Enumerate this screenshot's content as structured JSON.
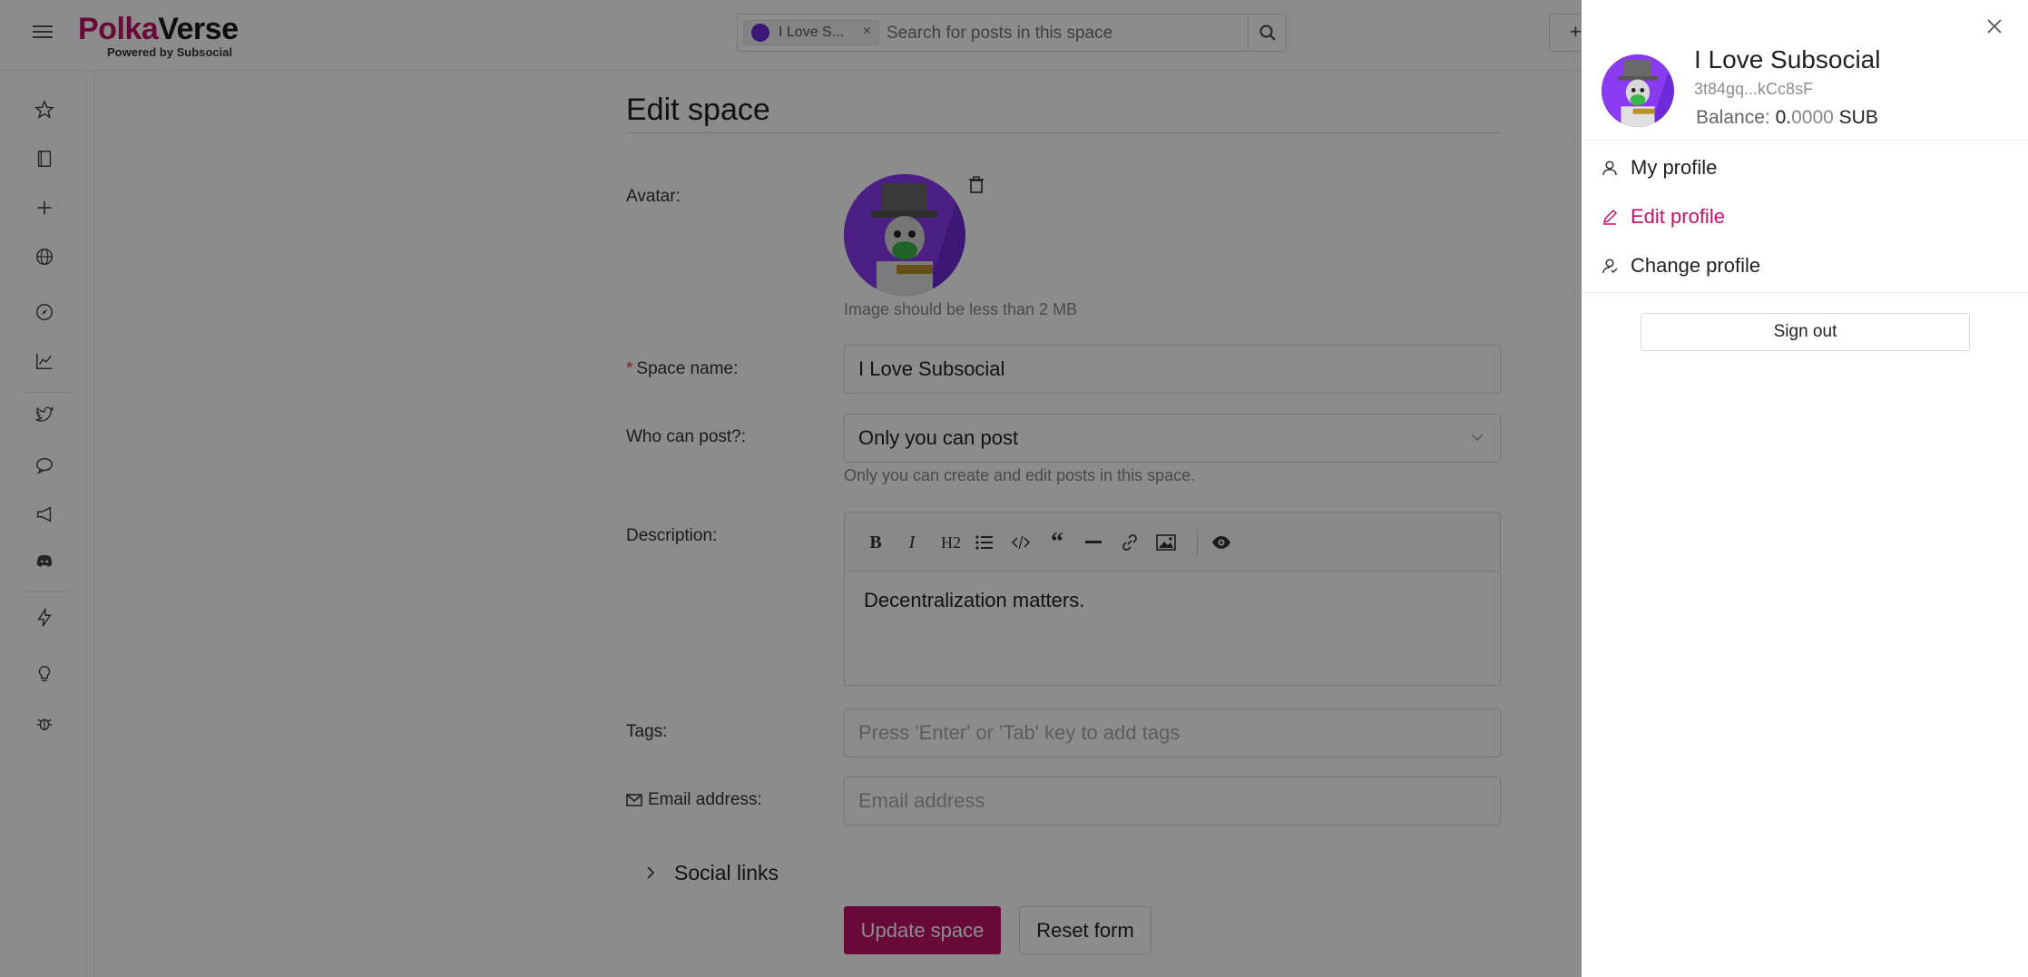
{
  "header": {
    "logo_part1": "Polka",
    "logo_part2": "Verse",
    "logo_subtitle": "Powered by Subsocial",
    "search_chip_label": "I Love S...",
    "search_chip_close": "×",
    "search_placeholder": "Search for posts in this space",
    "new_button_label": "+"
  },
  "sidebar": {
    "icons": [
      "star-icon",
      "book-icon",
      "plus-icon",
      "globe-icon",
      "compass-icon",
      "chart-icon",
      "twitter-icon",
      "chat-icon",
      "megaphone-icon",
      "discord-icon",
      "lightning-icon",
      "bulb-icon",
      "bug-icon"
    ]
  },
  "form": {
    "title": "Edit space",
    "avatar_label": "Avatar:",
    "avatar_hint": "Image should be less than 2 MB",
    "space_name_required": "*",
    "space_name_label": "Space name:",
    "space_name_value": "I Love Subsocial",
    "who_can_post_label": "Who can post?:",
    "who_can_post_value": "Only you can post",
    "who_can_post_hint": "Only you can create and edit posts in this space.",
    "description_label": "Description:",
    "description_value": "Decentralization matters.",
    "toolbar": {
      "bold": "B",
      "italic": "I",
      "heading": "H2"
    },
    "tags_label": "Tags:",
    "tags_placeholder": "Press 'Enter' or 'Tab' key to add tags",
    "email_label": "Email address:",
    "email_placeholder": "Email address",
    "social_links_label": "Social links",
    "update_button": "Update space",
    "reset_button": "Reset form"
  },
  "drawer": {
    "name": "I Love Subsocial",
    "address": "3t84gq...kCc8sF",
    "balance_label": "Balance:",
    "balance_int": "0.",
    "balance_dec": "0000",
    "balance_unit": "SUB",
    "items": [
      {
        "label": "My profile"
      },
      {
        "label": "Edit profile"
      },
      {
        "label": "Change profile"
      }
    ],
    "sign_out": "Sign out"
  },
  "colors": {
    "accent": "#c0126a",
    "avatar_purple": "#6d2ad8",
    "overlay": "rgba(0,0,0,0.45)"
  }
}
